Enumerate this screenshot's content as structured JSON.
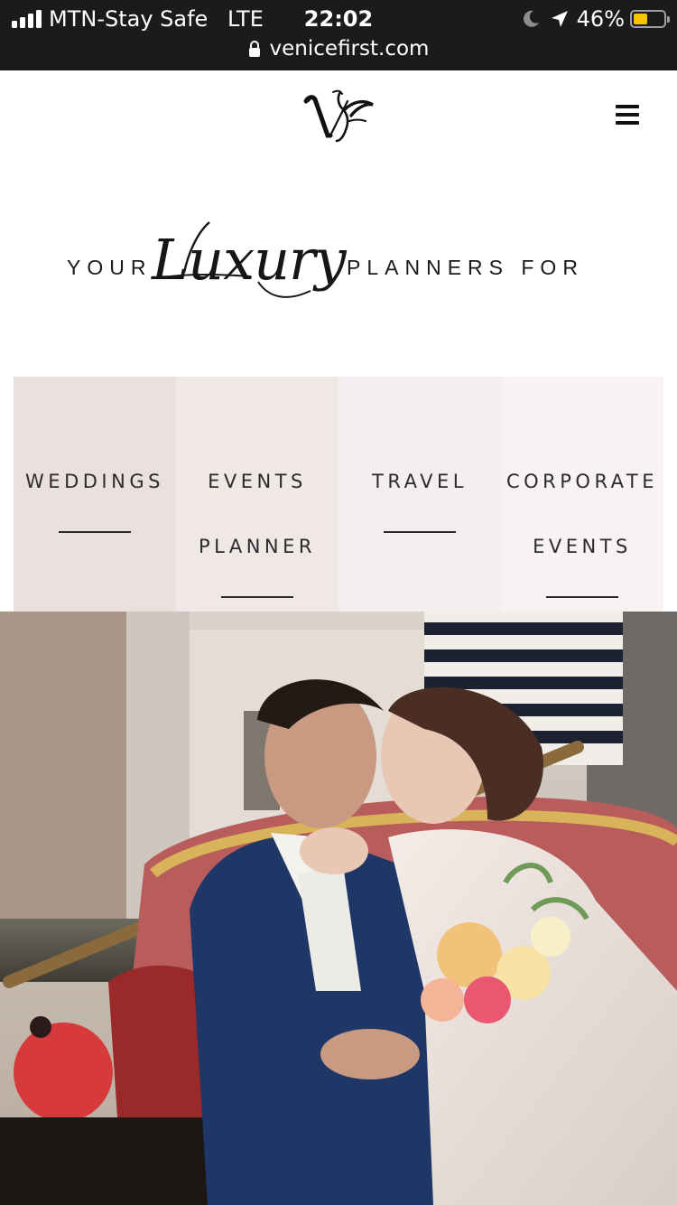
{
  "status_bar": {
    "carrier": "MTN-Stay Safe",
    "network": "LTE",
    "time": "22:02",
    "battery_percent": "46%",
    "battery_level": 0.46,
    "url": "venicefirst.com"
  },
  "header": {
    "logo_icon": "vf-monogram-logo",
    "menu_icon": "hamburger-menu-icon"
  },
  "headline": {
    "word_before": "YOUR",
    "script_word": "Luxury",
    "word_after": "PLANNERS FOR"
  },
  "tiles": [
    {
      "line1": "WEDDINGS",
      "line2": "",
      "bg": "#eae1df"
    },
    {
      "line1": "EVENTS",
      "line2": "PLANNER",
      "bg": "#efe8e6"
    },
    {
      "line1": "TRAVEL",
      "line2": "",
      "bg": "#f3efee"
    },
    {
      "line1": "CORPORATE",
      "line2": "EVENTS",
      "bg": "#f6f3f2"
    }
  ],
  "colors": {
    "status_bar_bg": "#1b1b1b",
    "battery_fill": "#f6c500",
    "text_dark": "#2b2b2b"
  }
}
